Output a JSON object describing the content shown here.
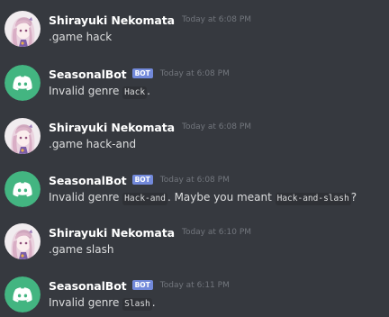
{
  "colors": {
    "background": "#36393f",
    "bot_avatar_bg": "#43b581",
    "bot_tag_bg": "#7289da",
    "username": "#ffffff",
    "timestamp": "#72767d",
    "text": "#dcddde",
    "code_bg": "#2f3136"
  },
  "messages": [
    {
      "author": "Shirayuki Nekomata",
      "avatar": "anime-girl-avatar",
      "bot": false,
      "timestamp": "Today at 6:08 PM",
      "text": ".game hack"
    },
    {
      "author": "SeasonalBot",
      "avatar": "discord-logo-icon",
      "bot": true,
      "bot_tag": "BOT",
      "timestamp": "Today at 6:08 PM",
      "parts": [
        "Invalid genre ",
        "Hack",
        "."
      ]
    },
    {
      "author": "Shirayuki Nekomata",
      "avatar": "anime-girl-avatar",
      "bot": false,
      "timestamp": "Today at 6:08 PM",
      "text": ".game hack-and"
    },
    {
      "author": "SeasonalBot",
      "avatar": "discord-logo-icon",
      "bot": true,
      "bot_tag": "BOT",
      "timestamp": "Today at 6:08 PM",
      "parts": [
        "Invalid genre ",
        "Hack-and",
        ". Maybe you meant ",
        "Hack-and-slash",
        "?"
      ]
    },
    {
      "author": "Shirayuki Nekomata",
      "avatar": "anime-girl-avatar",
      "bot": false,
      "timestamp": "Today at 6:10 PM",
      "text": ".game slash"
    },
    {
      "author": "SeasonalBot",
      "avatar": "discord-logo-icon",
      "bot": true,
      "bot_tag": "BOT",
      "timestamp": "Today at 6:11 PM",
      "parts": [
        "Invalid genre ",
        "Slash",
        "."
      ]
    }
  ]
}
